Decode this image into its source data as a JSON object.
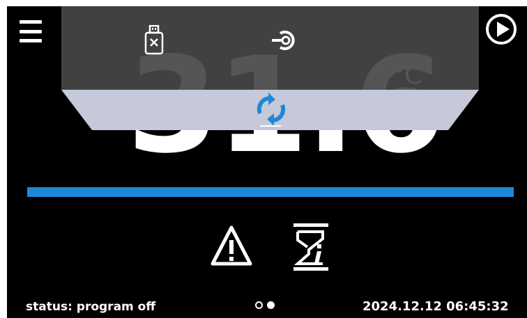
{
  "display": {
    "temperature": "31.6",
    "unit": "°C"
  },
  "toolbar": {
    "menu_icon": "hamburger-menu-icon",
    "play_icon": "play-circle-icon"
  },
  "top_panel": {
    "usb_icon": "usb-drive-remove-icon",
    "login_icon": "login-key-icon",
    "sync_icon": "sync-arrows-icon"
  },
  "progress": {
    "fraction": 1.0
  },
  "alerts": {
    "alarm_icon": "warning-triangle-icon",
    "program_icon": "hourglass-info-icon"
  },
  "footer": {
    "status": "status: program off",
    "pages_total": 2,
    "page_current": 2,
    "datetime": "2024.12.12  06:45:32"
  },
  "colors": {
    "background": "#000000",
    "accent": "#1e88d8",
    "panel": "#464646",
    "drawer": "#c6c9d9"
  }
}
